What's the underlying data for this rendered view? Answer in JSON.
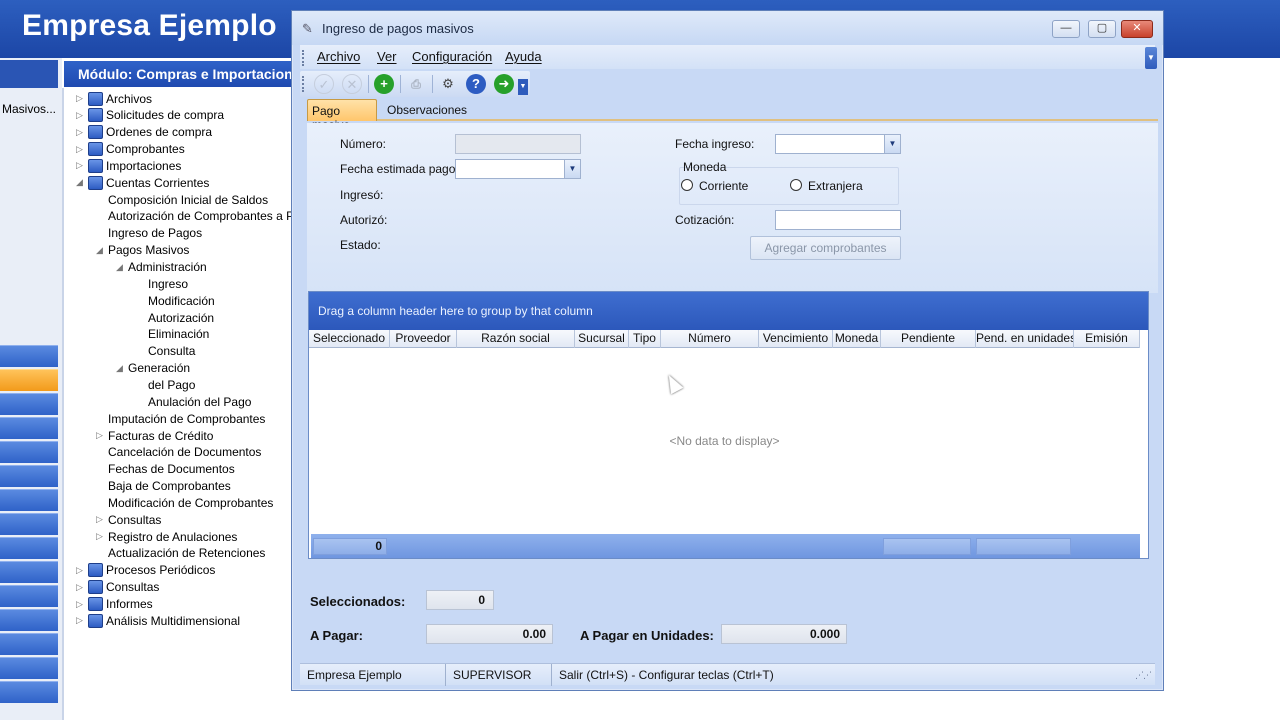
{
  "app": {
    "title": "Empresa Ejemplo",
    "module_title": "Módulo: Compras e Importaciones",
    "left_label": "Masivos..."
  },
  "tree": [
    {
      "label": "Archivos",
      "icon": "folder-icon",
      "level": 0,
      "expander": "▷"
    },
    {
      "label": "Solicitudes de compra",
      "icon": "request-icon",
      "level": 0,
      "expander": "▷"
    },
    {
      "label": "Ordenes de compra",
      "icon": "order-icon",
      "level": 0,
      "expander": "▷"
    },
    {
      "label": "Comprobantes",
      "icon": "voucher-icon",
      "level": 0,
      "expander": "▷"
    },
    {
      "label": "Importaciones",
      "icon": "import-icon",
      "level": 0,
      "expander": "▷"
    },
    {
      "label": "Cuentas Corrientes",
      "icon": "accounts-icon",
      "level": 0,
      "expander": "◢"
    },
    {
      "label": "Composición Inicial de Saldos",
      "level": 1,
      "expander": ""
    },
    {
      "label": "Autorización de Comprobantes a Pagar",
      "level": 1,
      "expander": ""
    },
    {
      "label": "Ingreso de Pagos",
      "level": 1,
      "expander": ""
    },
    {
      "label": "Pagos Masivos",
      "level": 1,
      "expander": "◢"
    },
    {
      "label": "Administración",
      "level": 2,
      "expander": "◢"
    },
    {
      "label": "Ingreso",
      "level": 3,
      "expander": ""
    },
    {
      "label": "Modificación",
      "level": 3,
      "expander": ""
    },
    {
      "label": "Autorización",
      "level": 3,
      "expander": ""
    },
    {
      "label": "Eliminación",
      "level": 3,
      "expander": ""
    },
    {
      "label": "Consulta",
      "level": 3,
      "expander": ""
    },
    {
      "label": "Generación",
      "level": 2,
      "expander": "◢"
    },
    {
      "label": "del Pago",
      "level": 3,
      "expander": ""
    },
    {
      "label": "Anulación del Pago",
      "level": 3,
      "expander": ""
    },
    {
      "label": "Imputación de Comprobantes",
      "level": 1,
      "expander": ""
    },
    {
      "label": "Facturas de Crédito",
      "level": 1,
      "expander": "▷"
    },
    {
      "label": "Cancelación de Documentos",
      "level": 1,
      "expander": ""
    },
    {
      "label": "Fechas de Documentos",
      "level": 1,
      "expander": ""
    },
    {
      "label": "Baja de Comprobantes",
      "level": 1,
      "expander": ""
    },
    {
      "label": "Modificación de Comprobantes",
      "level": 1,
      "expander": ""
    },
    {
      "label": "Consultas",
      "level": 1,
      "expander": "▷"
    },
    {
      "label": "Registro de Anulaciones",
      "level": 1,
      "expander": "▷"
    },
    {
      "label": "Actualización de Retenciones",
      "level": 1,
      "expander": ""
    },
    {
      "label": "Procesos Periódicos",
      "icon": "process-icon",
      "level": 0,
      "expander": "▷"
    },
    {
      "label": "Consultas",
      "icon": "star-icon",
      "level": 0,
      "expander": "▷"
    },
    {
      "label": "Informes",
      "icon": "report-icon",
      "level": 0,
      "expander": "▷"
    },
    {
      "label": "Análisis Multidimensional",
      "icon": "analysis-icon",
      "level": 0,
      "expander": "▷"
    }
  ],
  "dialog": {
    "title": "Ingreso de pagos masivos",
    "menu": [
      "Archivo",
      "Ver",
      "Configuración",
      "Ayuda"
    ],
    "tabs": [
      "Pago masivo",
      "Observaciones"
    ],
    "form": {
      "numero_label": "Número:",
      "fecha_estimada_label": "Fecha estimada pago:",
      "ingreso_label": "Ingresó:",
      "autorizo_label": "Autorizó:",
      "estado_label": "Estado:",
      "fecha_ingreso_label": "Fecha ingreso:",
      "moneda_label": "Moneda",
      "corriente_label": "Corriente",
      "extranjera_label": "Extranjera",
      "cotizacion_label": "Cotización:",
      "agregar_button": "Agregar comprobantes"
    },
    "grid": {
      "group_hint": "Drag a column header here to group by that column",
      "columns": [
        "Seleccionado",
        "Proveedor",
        "Razón social",
        "Sucursal",
        "Tipo",
        "Número",
        "Vencimiento",
        "Moneda",
        "Pendiente",
        "Pend. en unidades",
        "Emisión"
      ],
      "empty_text": "<No data to display>",
      "footer_count": "0"
    },
    "summary": {
      "seleccionados_label": "Seleccionados:",
      "seleccionados_value": "0",
      "a_pagar_label": "A Pagar:",
      "a_pagar_value": "0.00",
      "a_pagar_unidades_label": "A Pagar en Unidades:",
      "a_pagar_unidades_value": "0.000"
    },
    "status": {
      "company": "Empresa Ejemplo",
      "user": "SUPERVISOR",
      "shortcuts": "Salir (Ctrl+S) - Configurar teclas (Ctrl+T)"
    }
  }
}
